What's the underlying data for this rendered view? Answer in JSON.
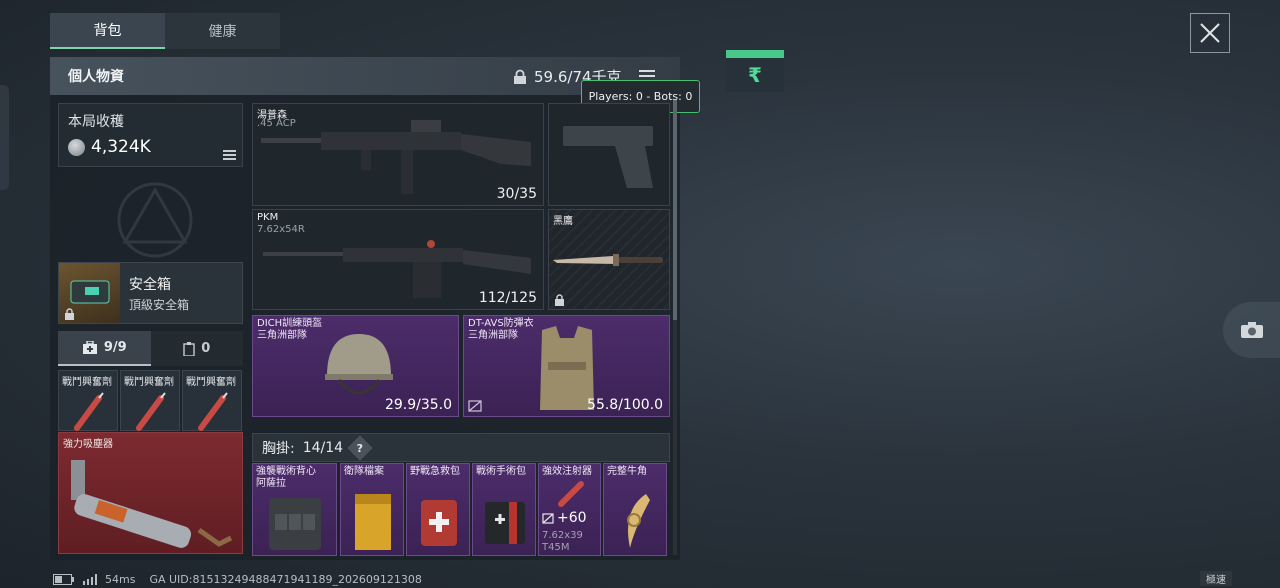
{
  "tabs": [
    {
      "label": "背包"
    },
    {
      "label": "健康"
    }
  ],
  "header": {
    "title": "個人物資",
    "weight": "59.6/74千克"
  },
  "tooltip": "Players: 0 - Bots: 0",
  "currency": {
    "symbol": "₹"
  },
  "earnings": {
    "label": "本局收穫",
    "value": "4,324K"
  },
  "safe_box": {
    "name": "安全箱",
    "type": "頂級安全箱"
  },
  "mini_tabs": [
    {
      "label": "9/9"
    },
    {
      "label": "0"
    }
  ],
  "syringes": [
    {
      "name": "戰鬥興奮劑"
    },
    {
      "name": "戰鬥興奮劑"
    },
    {
      "name": "戰鬥興奮劑"
    }
  ],
  "vacuum": {
    "name": "強力吸塵器"
  },
  "weapons": {
    "primary": {
      "name": "湯普森",
      "caliber": ".45 ACP",
      "ammo": "30/35"
    },
    "secondary": {
      "name": "PKM",
      "caliber": "7.62x54R",
      "ammo": "112/125"
    },
    "melee": {
      "name": "黑鷹"
    }
  },
  "helmet": {
    "name": "DICH訓練頭盔",
    "faction": "三角洲部隊",
    "durability": "29.9/35.0"
  },
  "armor": {
    "name": "DT-AVS防彈衣",
    "faction": "三角洲部隊",
    "durability": "55.8/100.0"
  },
  "rig": {
    "label": "胸掛:",
    "capacity": "14/14",
    "help": "?"
  },
  "rig_items": [
    {
      "name": "強襲戰術背心",
      "sub": "阿薩拉"
    },
    {
      "name": "衛隊檔案"
    },
    {
      "name": "野戰急救包"
    },
    {
      "name": "戰術手術包"
    },
    {
      "name": "強效注射器",
      "count": "+60",
      "sub": "7.62x39",
      "sub2": "T45M"
    },
    {
      "name": "完整牛角"
    }
  ],
  "status_bar": {
    "ping": "54ms",
    "uid": "GA UID:81513249488471941189_202609121308"
  },
  "speed_label": "極速",
  "colors": {
    "accent": "#7fd3a8",
    "purple": "#4c2c6a",
    "red": "#7d2a30",
    "tooltip_border": "#46c06f"
  }
}
